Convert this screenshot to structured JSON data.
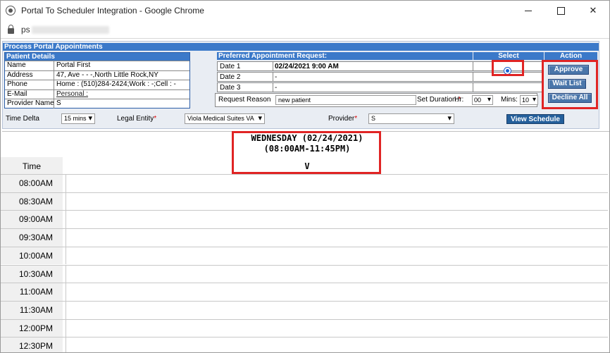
{
  "window": {
    "title": "Portal To Scheduler Integration - Google Chrome",
    "url_visible": "ps"
  },
  "panel": {
    "title": "Process Portal Appointments"
  },
  "patient": {
    "header": "Patient Details",
    "rows": [
      {
        "label": "Name",
        "value": "Portal First"
      },
      {
        "label": "Address",
        "value": "47, Ave - - -,North Little Rock,NY"
      },
      {
        "label": "Phone",
        "value": "Home : (510)284-2424;Work : -;Cell : -"
      },
      {
        "label": "E-Mail",
        "value": "Personal :"
      },
      {
        "label": "Provider Name",
        "value": "S"
      }
    ]
  },
  "request": {
    "header": "Preferred Appointment Request:",
    "select_header": "Select",
    "action_header": "Action",
    "dates": [
      {
        "label": "Date 1",
        "value": "02/24/2021 9:00 AM"
      },
      {
        "label": "Date 2",
        "value": "-"
      },
      {
        "label": "Date 3",
        "value": "-"
      }
    ],
    "reason_label": "Request Reason",
    "reason_value": "new patient",
    "duration_label": "Set Duration:",
    "hr_label": "Hr:",
    "hr_value": "00",
    "mins_label": "Mins:",
    "mins_value": "10"
  },
  "actions": {
    "approve": "Approve",
    "waitlist": "Wait List",
    "decline": "Decline All"
  },
  "filters": {
    "time_delta_label": "Time Delta",
    "time_delta_value": "15 mins",
    "legal_entity_label": "Legal Entity",
    "legal_entity_value": "Viola Medical Suites VA",
    "provider_label": "Provider",
    "provider_value": "S",
    "view_schedule": "View Schedule"
  },
  "schedule": {
    "day_line1": "WEDNESDAY (02/24/2021)",
    "day_line2": "(08:00AM-11:45PM)",
    "column_mark": "V",
    "time_header": "Time",
    "times": [
      "08:00AM",
      "08:30AM",
      "09:00AM",
      "09:30AM",
      "10:00AM",
      "10:30AM",
      "11:00AM",
      "11:30AM",
      "12:00PM",
      "12:30PM"
    ]
  },
  "colors": {
    "header_blue": "#3b79c9",
    "button_blue": "#4a76aa",
    "highlight_red": "#e02424"
  }
}
